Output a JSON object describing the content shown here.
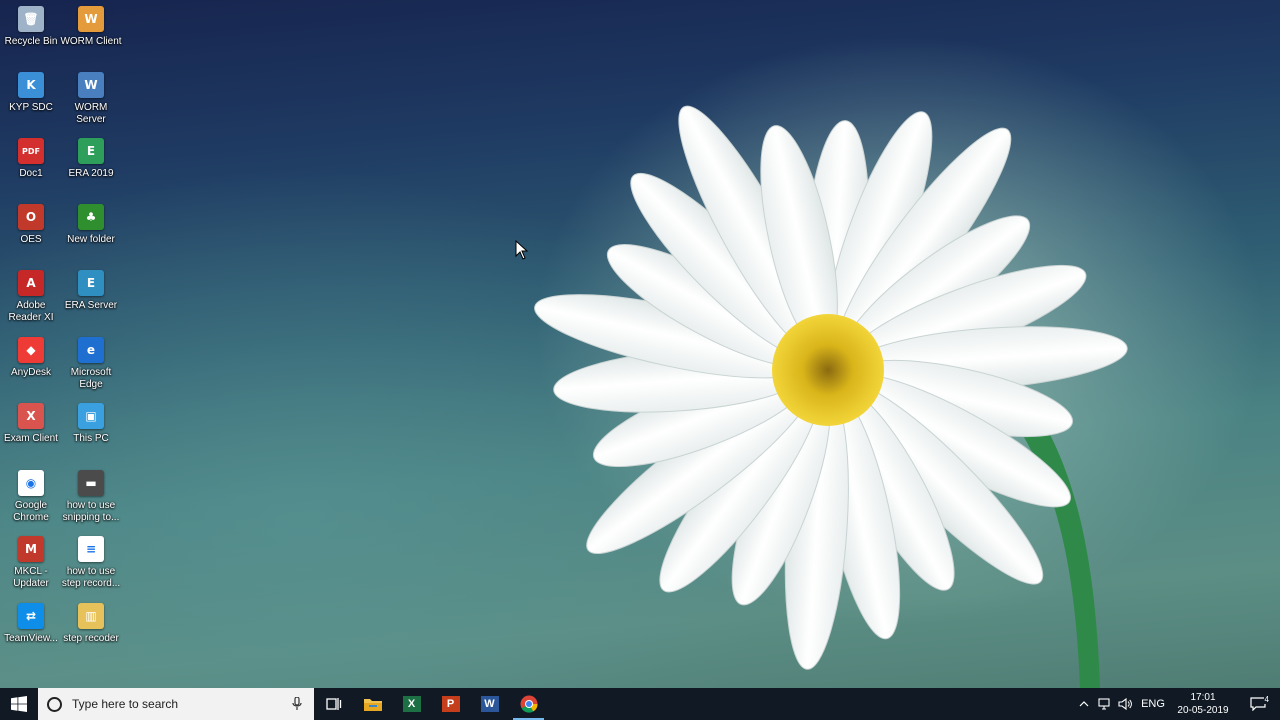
{
  "desktop": {
    "icons": [
      {
        "label": "Recycle Bin",
        "icon": "recycle-bin-icon",
        "color": "#9fb3c8",
        "glyph": "🗑"
      },
      {
        "label": "WORM Client",
        "icon": "worm-client-icon",
        "color": "#e39b3b",
        "glyph": "W"
      },
      {
        "label": "KYP SDC",
        "icon": "kyp-sdc-icon",
        "color": "#3b8fd6",
        "glyph": "K"
      },
      {
        "label": "WORM Server",
        "icon": "worm-server-icon",
        "color": "#4a7fbf",
        "glyph": "W"
      },
      {
        "label": "Doc1",
        "icon": "pdf-document-icon",
        "color": "#d32f2f",
        "glyph": "PDF"
      },
      {
        "label": "ERA 2019",
        "icon": "era-2019-icon",
        "color": "#2e9e5b",
        "glyph": "E"
      },
      {
        "label": "OES",
        "icon": "oes-icon",
        "color": "#c0392b",
        "glyph": "O"
      },
      {
        "label": "New folder",
        "icon": "tree-folder-icon",
        "color": "#2f8f2f",
        "glyph": "♣"
      },
      {
        "label": "Adobe Reader XI",
        "icon": "adobe-reader-icon",
        "color": "#c62828",
        "glyph": "A"
      },
      {
        "label": "ERA Server",
        "icon": "era-server-icon",
        "color": "#2e8fc0",
        "glyph": "E"
      },
      {
        "label": "AnyDesk",
        "icon": "anydesk-icon",
        "color": "#ef3b36",
        "glyph": "◆"
      },
      {
        "label": "Microsoft Edge",
        "icon": "edge-icon",
        "color": "#1e6fd0",
        "glyph": "e"
      },
      {
        "label": "Exam Client",
        "icon": "exam-client-icon",
        "color": "#d9534f",
        "glyph": "X"
      },
      {
        "label": "This PC",
        "icon": "this-pc-icon",
        "color": "#3aa0e0",
        "glyph": "▣"
      },
      {
        "label": "Google Chrome",
        "icon": "chrome-icon",
        "color": "#ffffff",
        "glyph": "◉"
      },
      {
        "label": "how to use snipping to...",
        "icon": "video-file-icon",
        "color": "#4b4b4b",
        "glyph": "▬"
      },
      {
        "label": "MKCL - Updater",
        "icon": "mkcl-updater-icon",
        "color": "#c0392b",
        "glyph": "M"
      },
      {
        "label": "how to use step record...",
        "icon": "document-file-icon",
        "color": "#ffffff",
        "glyph": "≡"
      },
      {
        "label": "TeamView...",
        "icon": "teamviewer-icon",
        "color": "#0e8ee9",
        "glyph": "⇄"
      },
      {
        "label": "step recoder",
        "icon": "zip-folder-icon",
        "color": "#e7c25a",
        "glyph": "▥"
      }
    ]
  },
  "taskbar": {
    "search_placeholder": "Type here to search",
    "apps": [
      {
        "name": "task-view-button",
        "icon": "task-view-icon"
      },
      {
        "name": "file-explorer-button",
        "icon": "folder-icon"
      },
      {
        "name": "excel-button",
        "icon": "excel-icon",
        "letter": "X",
        "color": "#1d7044"
      },
      {
        "name": "powerpoint-button",
        "icon": "powerpoint-icon",
        "letter": "P",
        "color": "#c43e1c"
      },
      {
        "name": "word-button",
        "icon": "word-icon",
        "letter": "W",
        "color": "#2b579a"
      },
      {
        "name": "chrome-button",
        "icon": "chrome-icon",
        "active": true
      }
    ],
    "tray": {
      "language": "ENG",
      "time": "17:01",
      "date": "20-05-2019",
      "notification_count": "4"
    }
  }
}
